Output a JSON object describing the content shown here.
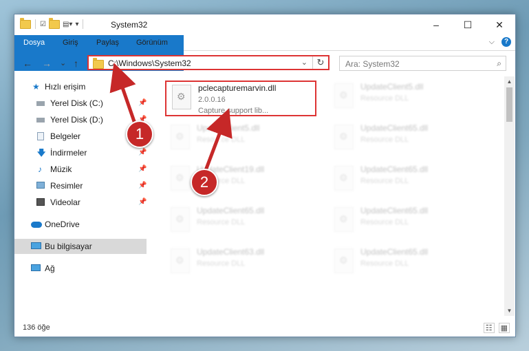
{
  "window": {
    "title": "System32",
    "quick_access_icons": [
      "folder-icon",
      "properties-icon",
      "new-folder-icon",
      "customize-icon"
    ],
    "controls": {
      "minimize": "–",
      "maximize": "☐",
      "close": "✕"
    }
  },
  "ribbon": {
    "tabs": [
      {
        "label": "Dosya",
        "active": true
      },
      {
        "label": "Giriş"
      },
      {
        "label": "Paylaş"
      },
      {
        "label": "Görünüm"
      }
    ],
    "expand_glyph": "⌵",
    "help_glyph": "?"
  },
  "navigation": {
    "back": "←",
    "forward": "→",
    "recent": "⌄",
    "up": "↑",
    "address": "C:\\Windows\\System32",
    "address_dropdown": "⌄",
    "refresh": "↻",
    "search_placeholder": "Ara: System32",
    "search_icon": "⌕"
  },
  "sidebar": {
    "items": [
      {
        "label": "Hızlı erişim",
        "icon": "star-icon",
        "pinned": false
      },
      {
        "label": "Yerel Disk (C:)",
        "icon": "drive-icon",
        "pinned": true
      },
      {
        "label": "Yerel Disk (D:)",
        "icon": "drive-icon",
        "pinned": true
      },
      {
        "label": "Belgeler",
        "icon": "document-icon",
        "pinned": true
      },
      {
        "label": "İndirmeler",
        "icon": "download-icon",
        "pinned": true
      },
      {
        "label": "Müzik",
        "icon": "music-icon",
        "pinned": true
      },
      {
        "label": "Resimler",
        "icon": "pictures-icon",
        "pinned": true
      },
      {
        "label": "Videolar",
        "icon": "video-icon",
        "pinned": true
      },
      {
        "label": "OneDrive",
        "icon": "cloud-icon",
        "pinned": false
      },
      {
        "label": "Bu bilgisayar",
        "icon": "computer-icon",
        "pinned": false,
        "selected": true
      },
      {
        "label": "Ağ",
        "icon": "network-icon",
        "pinned": false
      }
    ],
    "pin_glyph": "📌"
  },
  "files": [
    {
      "name": "pclecapturemarvin.dll",
      "line2": "2.0.0.16",
      "line3": "Capture support lib...",
      "highlighted": true
    },
    {
      "name": "UpdateClient5.dll",
      "line2": "Resource DLL",
      "line3": ""
    },
    {
      "name": "UpdateClient5.dll",
      "line2": "Resource DLL",
      "line3": ""
    },
    {
      "name": "UpdateClient65.dll",
      "line2": "Resource DLL",
      "line3": ""
    },
    {
      "name": "UpdateClient19.dll",
      "line2": "Resource DLL",
      "line3": ""
    },
    {
      "name": "UpdateClient65.dll",
      "line2": "Resource DLL",
      "line3": ""
    },
    {
      "name": "UpdateClient65.dll",
      "line2": "Resource DLL",
      "line3": ""
    },
    {
      "name": "UpdateClient65.dll",
      "line2": "Resource DLL",
      "line3": ""
    },
    {
      "name": "UpdateClient63.dll",
      "line2": "Resource DLL",
      "line3": ""
    },
    {
      "name": "UpdateClient65.dll",
      "line2": "Resource DLL",
      "line3": ""
    }
  ],
  "status": {
    "item_count": "136 öğe",
    "view_details": "☷",
    "view_tiles": "▦"
  },
  "annotations": {
    "badge1": "1",
    "badge2": "2",
    "color": "#c62828"
  },
  "scrollbar": {
    "up": "▲",
    "down": "▼"
  }
}
